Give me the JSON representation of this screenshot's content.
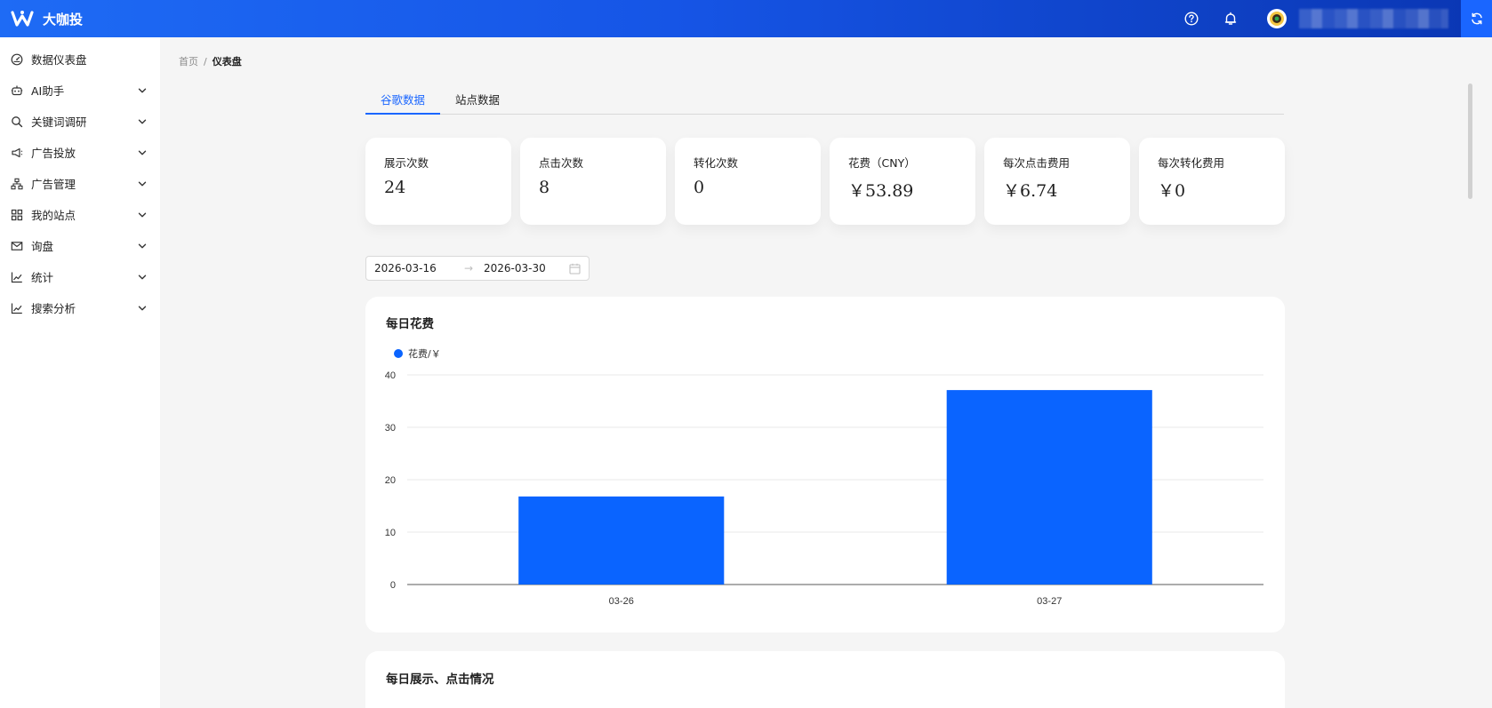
{
  "app": {
    "name": "大咖投",
    "brand_color": "#1a66ff"
  },
  "header": {
    "help_icon": "question-circle-icon",
    "bell_icon": "bell-icon",
    "refresh_icon": "refresh-icon"
  },
  "sidebar": {
    "items": [
      {
        "label": "数据仪表盘",
        "icon": "dashboard-icon",
        "has_chevron": false
      },
      {
        "label": "AI助手",
        "icon": "robot-icon",
        "has_chevron": true
      },
      {
        "label": "关键词调研",
        "icon": "search-icon",
        "has_chevron": true
      },
      {
        "label": "广告投放",
        "icon": "megaphone-icon",
        "has_chevron": true
      },
      {
        "label": "广告管理",
        "icon": "org-chart-icon",
        "has_chevron": true
      },
      {
        "label": "我的站点",
        "icon": "grid-icon",
        "has_chevron": true
      },
      {
        "label": "询盘",
        "icon": "mail-icon",
        "has_chevron": true
      },
      {
        "label": "统计",
        "icon": "line-chart-icon",
        "has_chevron": true
      },
      {
        "label": "搜索分析",
        "icon": "line-chart-icon",
        "has_chevron": true
      }
    ]
  },
  "breadcrumb": {
    "home": "首页",
    "separator": "/",
    "current": "仪表盘"
  },
  "tabs": [
    {
      "label": "谷歌数据",
      "active": true
    },
    {
      "label": "站点数据",
      "active": false
    }
  ],
  "stats": [
    {
      "label": "展示次数",
      "value": "24"
    },
    {
      "label": "点击次数",
      "value": "8"
    },
    {
      "label": "转化次数",
      "value": "0"
    },
    {
      "label": "花费（CNY）",
      "value": "￥53.89"
    },
    {
      "label": "每次点击费用",
      "value": "￥6.74"
    },
    {
      "label": "每次转化费用",
      "value": "￥0"
    }
  ],
  "date_range": {
    "start": "2026-03-16",
    "separator": "→",
    "end": "2026-03-30"
  },
  "chart_data": {
    "type": "bar",
    "title": "每日花费",
    "categories": [
      "03-26",
      "03-27"
    ],
    "series": [
      {
        "name": "花费/￥",
        "values": [
          16.8,
          37.1
        ],
        "color": "#0a64ff"
      }
    ],
    "ylim": [
      0,
      40
    ],
    "yticks": [
      0,
      10,
      20,
      30,
      40
    ],
    "xlabel": "",
    "ylabel": "",
    "grid": true,
    "legend_position": "top-left"
  },
  "second_chart": {
    "title": "每日展示、点击情况"
  }
}
